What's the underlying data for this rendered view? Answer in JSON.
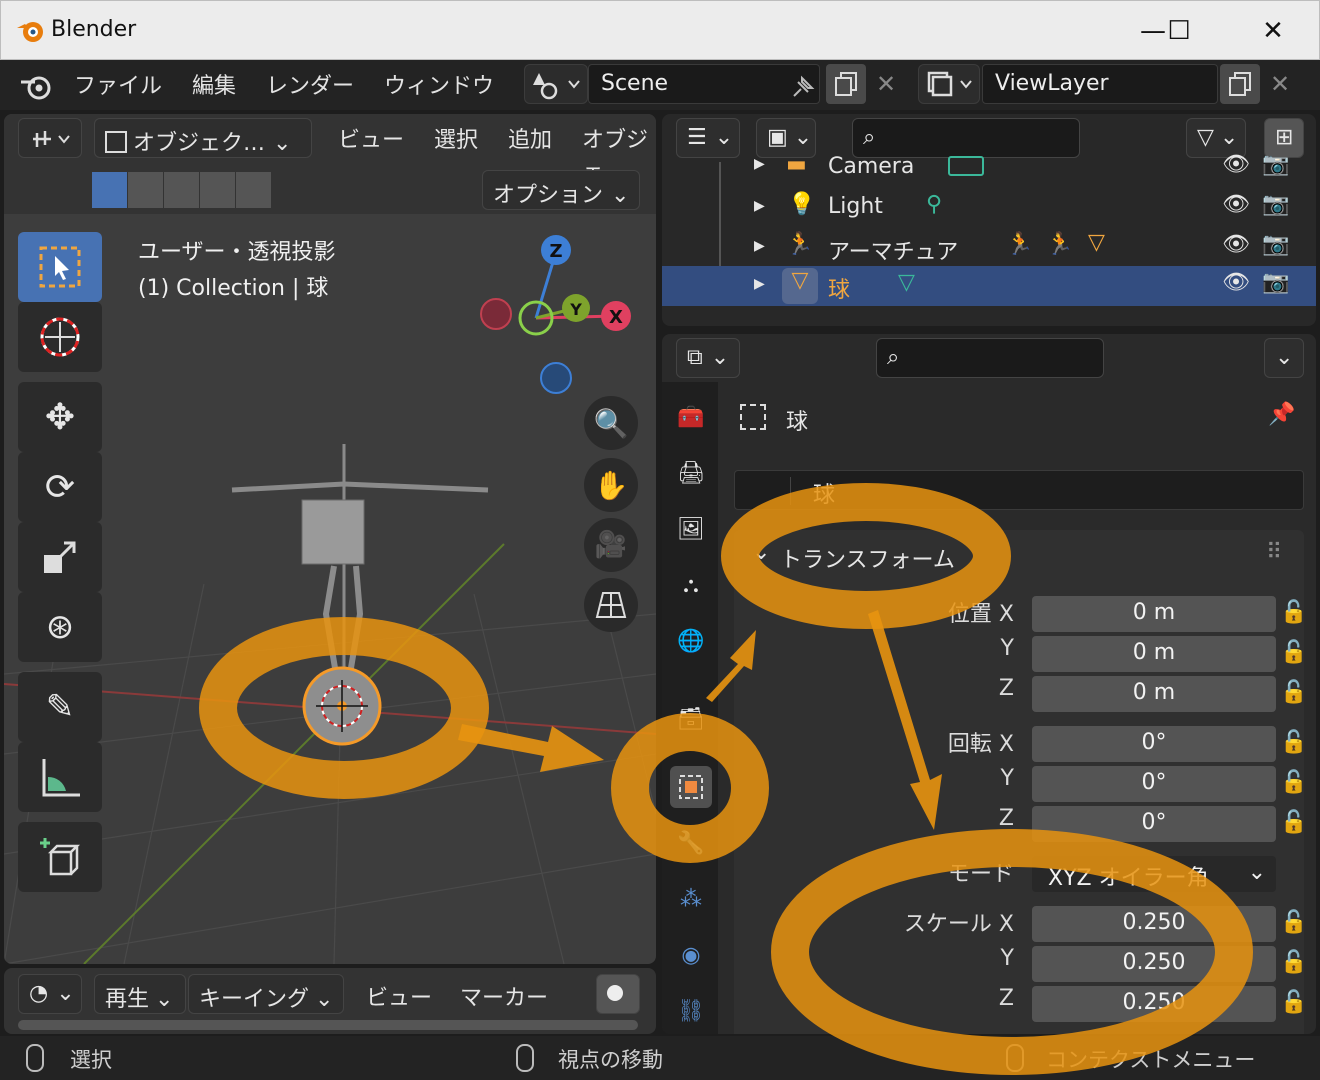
{
  "window": {
    "title": "Blender",
    "controls": {
      "minimize": "—",
      "maximize": "☐",
      "close": "✕"
    }
  },
  "menubar": {
    "items": [
      "ファイル",
      "編集",
      "レンダー",
      "ウィンドウ"
    ],
    "scene": "Scene",
    "view_layer": "ViewLayer"
  },
  "viewport": {
    "mode_dropdown": "オブジェク…",
    "menus": [
      "ビュー",
      "選択",
      "追加",
      "オブジェ"
    ],
    "options_button": "オプション",
    "overlay_title": "ユーザー・透視投影",
    "overlay_collection": "(1) Collection | 球",
    "gizmo_axes": {
      "z": "Z",
      "y": "Y",
      "x": "X"
    }
  },
  "outliner": {
    "rows": [
      {
        "name": "Camera",
        "selected": false
      },
      {
        "name": "Light",
        "selected": false
      },
      {
        "name": "アーマチュア",
        "selected": false
      },
      {
        "name": "球",
        "selected": true
      }
    ]
  },
  "properties": {
    "object_header": "球",
    "object_name_field": "球",
    "panel_title": "トランスフォーム",
    "location_label": "位置 X",
    "rotation_label": "回転 X",
    "scale_label": "スケール X",
    "axis_y": "Y",
    "axis_z": "Z",
    "location": [
      "0 m",
      "0 m",
      "0 m"
    ],
    "rotation": [
      "0°",
      "0°",
      "0°"
    ],
    "mode_label": "モード",
    "mode_value": "XYZ オイラー角",
    "scale": [
      "0.250",
      "0.250",
      "0.250"
    ]
  },
  "timeline": {
    "menus": [
      "再生",
      "キーイング",
      "ビュー",
      "マーカー"
    ]
  },
  "statusbar": {
    "items": [
      "選択",
      "視点の移動",
      "コンテクストメニュー"
    ]
  },
  "colors": {
    "accent_orange": "#e8930f",
    "selection_blue": "#334d80",
    "active_tool_blue": "#4772b3"
  }
}
